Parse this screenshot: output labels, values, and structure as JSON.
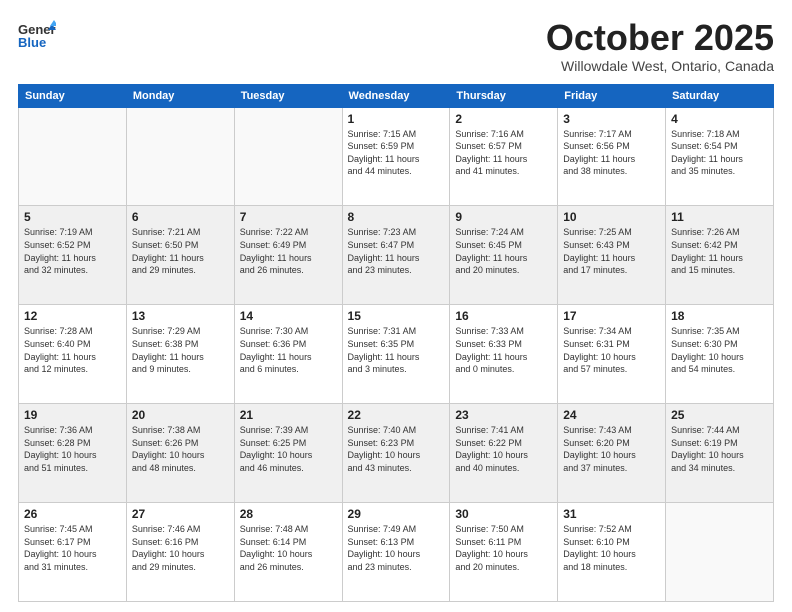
{
  "header": {
    "logo_general": "General",
    "logo_blue": "Blue",
    "month": "October 2025",
    "location": "Willowdale West, Ontario, Canada"
  },
  "weekdays": [
    "Sunday",
    "Monday",
    "Tuesday",
    "Wednesday",
    "Thursday",
    "Friday",
    "Saturday"
  ],
  "weeks": [
    [
      {
        "day": "",
        "info": ""
      },
      {
        "day": "",
        "info": ""
      },
      {
        "day": "",
        "info": ""
      },
      {
        "day": "1",
        "info": "Sunrise: 7:15 AM\nSunset: 6:59 PM\nDaylight: 11 hours\nand 44 minutes."
      },
      {
        "day": "2",
        "info": "Sunrise: 7:16 AM\nSunset: 6:57 PM\nDaylight: 11 hours\nand 41 minutes."
      },
      {
        "day": "3",
        "info": "Sunrise: 7:17 AM\nSunset: 6:56 PM\nDaylight: 11 hours\nand 38 minutes."
      },
      {
        "day": "4",
        "info": "Sunrise: 7:18 AM\nSunset: 6:54 PM\nDaylight: 11 hours\nand 35 minutes."
      }
    ],
    [
      {
        "day": "5",
        "info": "Sunrise: 7:19 AM\nSunset: 6:52 PM\nDaylight: 11 hours\nand 32 minutes."
      },
      {
        "day": "6",
        "info": "Sunrise: 7:21 AM\nSunset: 6:50 PM\nDaylight: 11 hours\nand 29 minutes."
      },
      {
        "day": "7",
        "info": "Sunrise: 7:22 AM\nSunset: 6:49 PM\nDaylight: 11 hours\nand 26 minutes."
      },
      {
        "day": "8",
        "info": "Sunrise: 7:23 AM\nSunset: 6:47 PM\nDaylight: 11 hours\nand 23 minutes."
      },
      {
        "day": "9",
        "info": "Sunrise: 7:24 AM\nSunset: 6:45 PM\nDaylight: 11 hours\nand 20 minutes."
      },
      {
        "day": "10",
        "info": "Sunrise: 7:25 AM\nSunset: 6:43 PM\nDaylight: 11 hours\nand 17 minutes."
      },
      {
        "day": "11",
        "info": "Sunrise: 7:26 AM\nSunset: 6:42 PM\nDaylight: 11 hours\nand 15 minutes."
      }
    ],
    [
      {
        "day": "12",
        "info": "Sunrise: 7:28 AM\nSunset: 6:40 PM\nDaylight: 11 hours\nand 12 minutes."
      },
      {
        "day": "13",
        "info": "Sunrise: 7:29 AM\nSunset: 6:38 PM\nDaylight: 11 hours\nand 9 minutes."
      },
      {
        "day": "14",
        "info": "Sunrise: 7:30 AM\nSunset: 6:36 PM\nDaylight: 11 hours\nand 6 minutes."
      },
      {
        "day": "15",
        "info": "Sunrise: 7:31 AM\nSunset: 6:35 PM\nDaylight: 11 hours\nand 3 minutes."
      },
      {
        "day": "16",
        "info": "Sunrise: 7:33 AM\nSunset: 6:33 PM\nDaylight: 11 hours\nand 0 minutes."
      },
      {
        "day": "17",
        "info": "Sunrise: 7:34 AM\nSunset: 6:31 PM\nDaylight: 10 hours\nand 57 minutes."
      },
      {
        "day": "18",
        "info": "Sunrise: 7:35 AM\nSunset: 6:30 PM\nDaylight: 10 hours\nand 54 minutes."
      }
    ],
    [
      {
        "day": "19",
        "info": "Sunrise: 7:36 AM\nSunset: 6:28 PM\nDaylight: 10 hours\nand 51 minutes."
      },
      {
        "day": "20",
        "info": "Sunrise: 7:38 AM\nSunset: 6:26 PM\nDaylight: 10 hours\nand 48 minutes."
      },
      {
        "day": "21",
        "info": "Sunrise: 7:39 AM\nSunset: 6:25 PM\nDaylight: 10 hours\nand 46 minutes."
      },
      {
        "day": "22",
        "info": "Sunrise: 7:40 AM\nSunset: 6:23 PM\nDaylight: 10 hours\nand 43 minutes."
      },
      {
        "day": "23",
        "info": "Sunrise: 7:41 AM\nSunset: 6:22 PM\nDaylight: 10 hours\nand 40 minutes."
      },
      {
        "day": "24",
        "info": "Sunrise: 7:43 AM\nSunset: 6:20 PM\nDaylight: 10 hours\nand 37 minutes."
      },
      {
        "day": "25",
        "info": "Sunrise: 7:44 AM\nSunset: 6:19 PM\nDaylight: 10 hours\nand 34 minutes."
      }
    ],
    [
      {
        "day": "26",
        "info": "Sunrise: 7:45 AM\nSunset: 6:17 PM\nDaylight: 10 hours\nand 31 minutes."
      },
      {
        "day": "27",
        "info": "Sunrise: 7:46 AM\nSunset: 6:16 PM\nDaylight: 10 hours\nand 29 minutes."
      },
      {
        "day": "28",
        "info": "Sunrise: 7:48 AM\nSunset: 6:14 PM\nDaylight: 10 hours\nand 26 minutes."
      },
      {
        "day": "29",
        "info": "Sunrise: 7:49 AM\nSunset: 6:13 PM\nDaylight: 10 hours\nand 23 minutes."
      },
      {
        "day": "30",
        "info": "Sunrise: 7:50 AM\nSunset: 6:11 PM\nDaylight: 10 hours\nand 20 minutes."
      },
      {
        "day": "31",
        "info": "Sunrise: 7:52 AM\nSunset: 6:10 PM\nDaylight: 10 hours\nand 18 minutes."
      },
      {
        "day": "",
        "info": ""
      }
    ]
  ],
  "row_shades": [
    "white",
    "shade",
    "white",
    "shade",
    "white"
  ]
}
